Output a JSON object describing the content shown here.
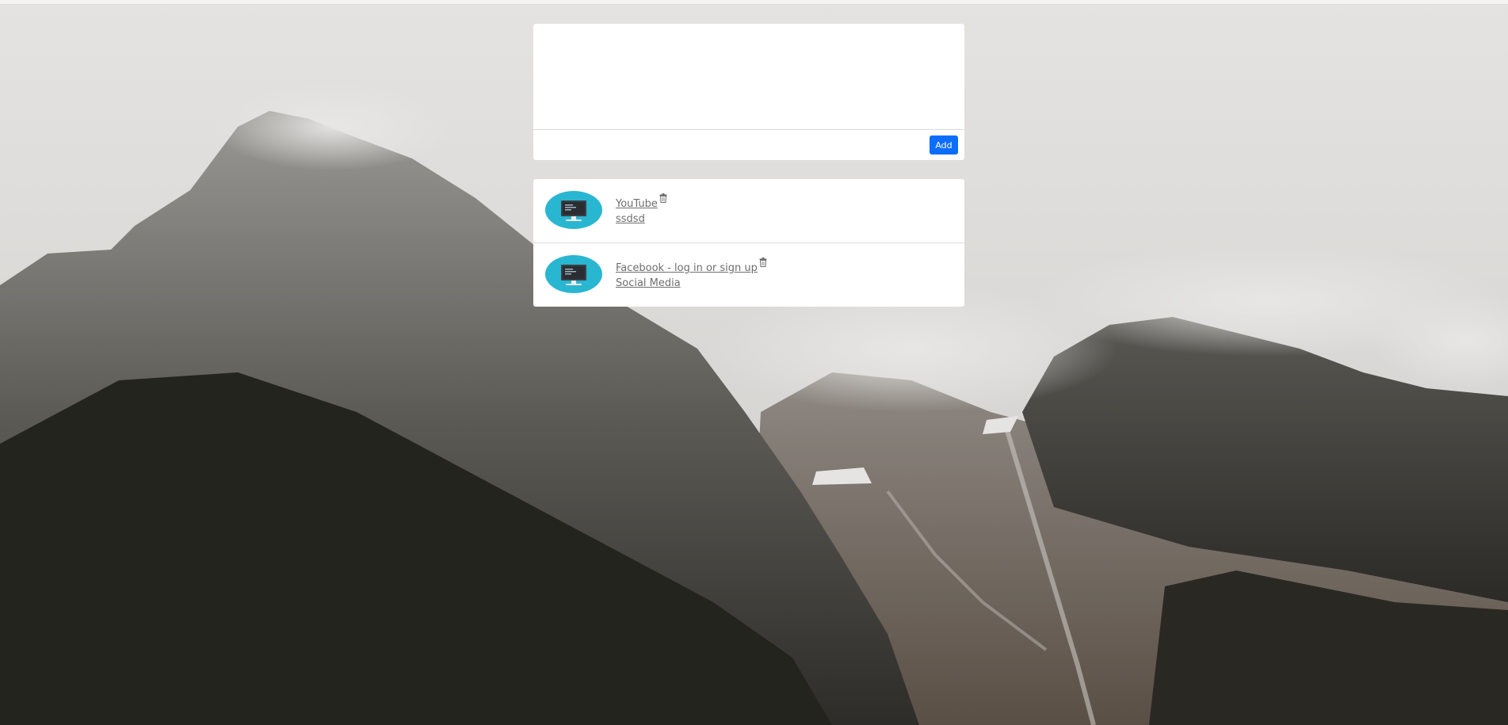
{
  "composer": {
    "text_value": "",
    "add_label": "Add"
  },
  "bookmarks": [
    {
      "title": "YouTube",
      "subtitle": "ssdsd",
      "icon": "monitor-icon"
    },
    {
      "title": "Facebook - log in or sign up",
      "subtitle": "Social Media",
      "icon": "monitor-icon"
    }
  ],
  "colors": {
    "accent": "#0d6efd",
    "thumb": "#29b6d1",
    "link_text": "#6e6e6e"
  }
}
